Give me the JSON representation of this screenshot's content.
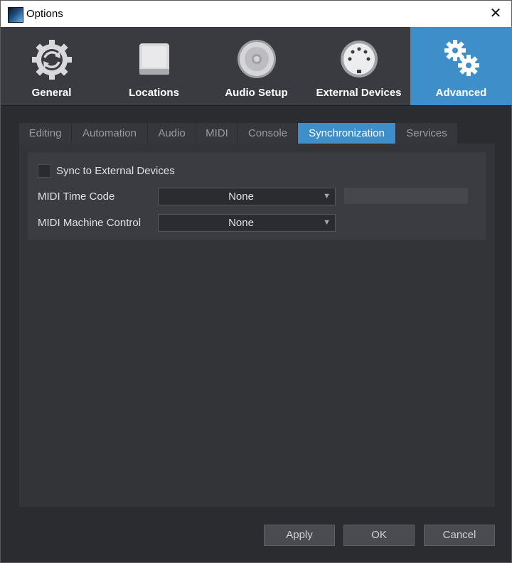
{
  "window": {
    "title": "Options",
    "close_glyph": "✕"
  },
  "categories": [
    {
      "label": "General",
      "icon": "sync-gear-icon",
      "active": false
    },
    {
      "label": "Locations",
      "icon": "drive-icon",
      "active": false
    },
    {
      "label": "Audio Setup",
      "icon": "speaker-icon",
      "active": false
    },
    {
      "label": "External Devices",
      "icon": "midi-connector-icon",
      "active": false
    },
    {
      "label": "Advanced",
      "icon": "gears-icon",
      "active": true
    }
  ],
  "tabs": [
    {
      "label": "Editing",
      "active": false
    },
    {
      "label": "Automation",
      "active": false
    },
    {
      "label": "Audio",
      "active": false
    },
    {
      "label": "MIDI",
      "active": false
    },
    {
      "label": "Console",
      "active": false
    },
    {
      "label": "Synchronization",
      "active": true
    },
    {
      "label": "Services",
      "active": false
    }
  ],
  "sync": {
    "sync_checkbox_label": "Sync to External Devices",
    "sync_checked": false,
    "mtc_label": "MIDI Time Code",
    "mtc_value": "None",
    "mmc_label": "MIDI Machine Control",
    "mmc_value": "None"
  },
  "buttons": {
    "apply": "Apply",
    "ok": "OK",
    "cancel": "Cancel"
  },
  "colors": {
    "accent": "#3e8ec9",
    "background": "#2b2c30"
  }
}
